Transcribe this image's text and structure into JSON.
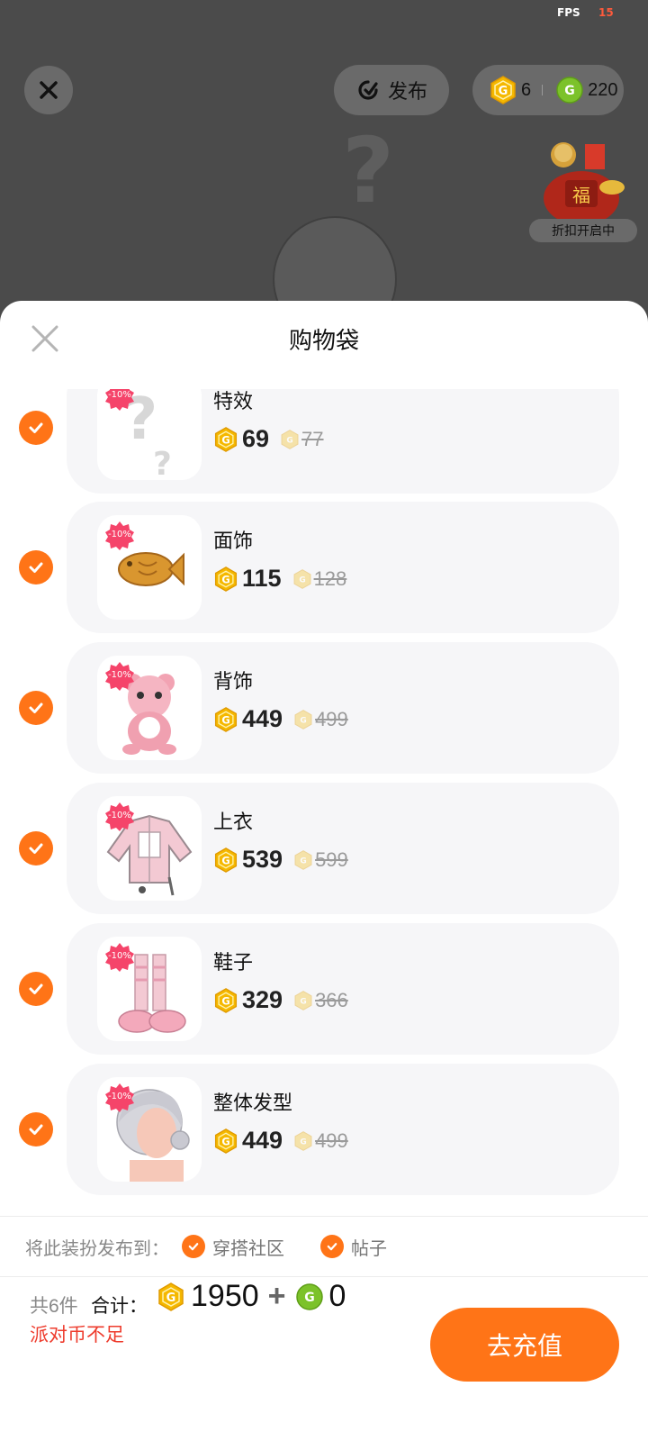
{
  "status": {
    "fps_label": "FPS",
    "fps_value": "15"
  },
  "top_bar": {
    "publish_label": "发布",
    "gold_coins": "6",
    "green_coins": "220",
    "promo_label": "折扣开启中"
  },
  "sheet": {
    "title": "购物袋",
    "items": [
      {
        "name": "特效",
        "discount": "-10%",
        "price": "69",
        "original_price": "77",
        "checked": true
      },
      {
        "name": "面饰",
        "discount": "-10%",
        "price": "115",
        "original_price": "128",
        "checked": true
      },
      {
        "name": "背饰",
        "discount": "-10%",
        "price": "449",
        "original_price": "499",
        "checked": true
      },
      {
        "name": "上衣",
        "discount": "-10%",
        "price": "539",
        "original_price": "599",
        "checked": true
      },
      {
        "name": "鞋子",
        "discount": "-10%",
        "price": "329",
        "original_price": "366",
        "checked": true
      },
      {
        "name": "整体发型",
        "discount": "-10%",
        "price": "449",
        "original_price": "499",
        "checked": true
      }
    ],
    "publish_to": {
      "label": "将此装扮发布到：",
      "options": [
        {
          "label": "穿搭社区",
          "checked": true
        },
        {
          "label": "帖子",
          "checked": true
        }
      ]
    },
    "footer": {
      "count_text": "共6件",
      "total_label": "合计：",
      "gold_total": "1950",
      "plus": "+",
      "green_total": "0",
      "warning": "派对币不足",
      "recharge_label": "去充值"
    }
  },
  "colors": {
    "accent": "#ff7417",
    "badge": "#f5446a",
    "warning": "#ee3b2c",
    "gold": "#f5b800",
    "green": "#7cc22a"
  }
}
